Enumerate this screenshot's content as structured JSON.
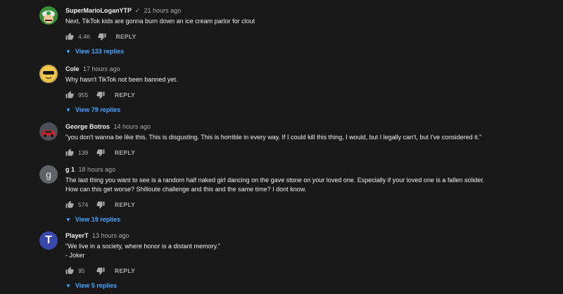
{
  "comments": [
    {
      "author": "SuperMarioLoganYTP",
      "verified_icon": "check-icon",
      "verified_glyph": "✓",
      "time": "21 hours ago",
      "text": "Next, TikTok kids are gonna burn down an ice cream parlor for clout",
      "likes": "4.4K",
      "reply_label": "REPLY",
      "view_replies": "View 133 replies",
      "chevron": "▼"
    },
    {
      "author": "Cole",
      "time": "17 hours ago",
      "text": "Why hasn't TikTok not been banned yet.",
      "likes": "955",
      "reply_label": "REPLY",
      "view_replies": "View 79 replies",
      "chevron": "▼"
    },
    {
      "author": "George Botros",
      "time": "14 hours ago",
      "text": "\"you don't wanna be like this. This is disgusting. This is horrible in every way. If I could kill this thing, I would, but I legally can't, but I've considered it.\"",
      "likes": "139",
      "reply_label": "REPLY"
    },
    {
      "author": "g 1",
      "avatar_letter": "g",
      "time": "18 hours ago",
      "text": "The last thing you want to see is a random half naked girl dancing on the gave stone on your loved one. Especially if your loved one is a fallen solider.\nHow can this get worse? Shilloute challenge and this and the same time? I dont know.",
      "likes": "574",
      "reply_label": "REPLY",
      "view_replies": "View 19 replies",
      "chevron": "▼"
    },
    {
      "author": "PlayerT",
      "avatar_letter": "T",
      "time": "13 hours ago",
      "text": "\"We live in a society, where honor is a distant memory.\"\n- Joker",
      "likes": "95",
      "reply_label": "REPLY",
      "view_replies": "View 5 replies",
      "chevron": "▼"
    }
  ],
  "colors": {
    "background": "#181818",
    "text": "#f1f1f1",
    "secondary": "#aaaaaa",
    "link": "#3ea6ff"
  }
}
